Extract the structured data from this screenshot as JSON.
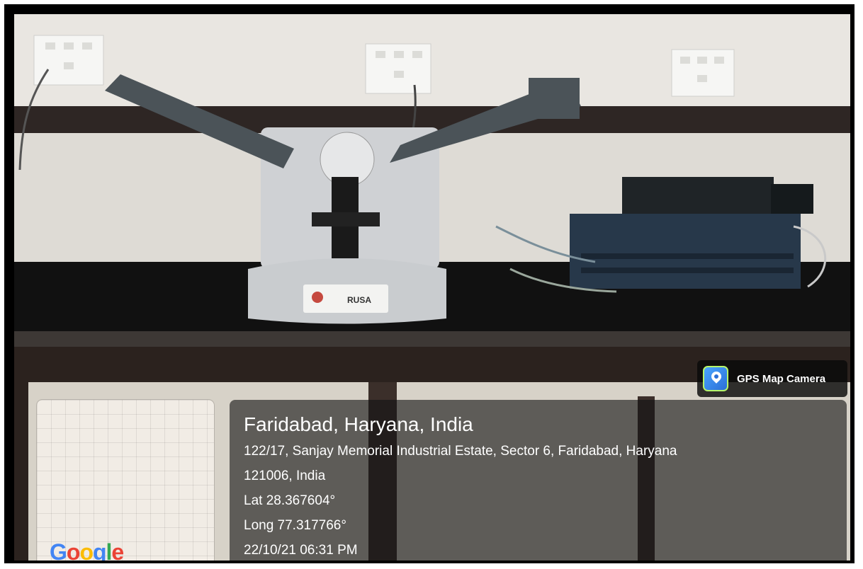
{
  "photo": {
    "subject": "laboratory spectrometer on granite bench with controller box",
    "instrument_label": "RUSA"
  },
  "map": {
    "provider_logo": "Google",
    "logo_colors": [
      "#4285F4",
      "#EA4335",
      "#FBBC05",
      "#4285F4",
      "#34A853",
      "#EA4335"
    ]
  },
  "app_badge": {
    "name": "GPS Map Camera",
    "icon": "gps-map-camera-icon"
  },
  "caption": {
    "title": "Faridabad, Haryana, India",
    "address_line1": "122/17, Sanjay Memorial Industrial Estate, Sector 6, Faridabad, Haryana",
    "address_line2": "121006, India",
    "latitude": "Lat 28.367604°",
    "longitude": "Long 77.317766°",
    "datetime": "22/10/21 06:31 PM"
  }
}
